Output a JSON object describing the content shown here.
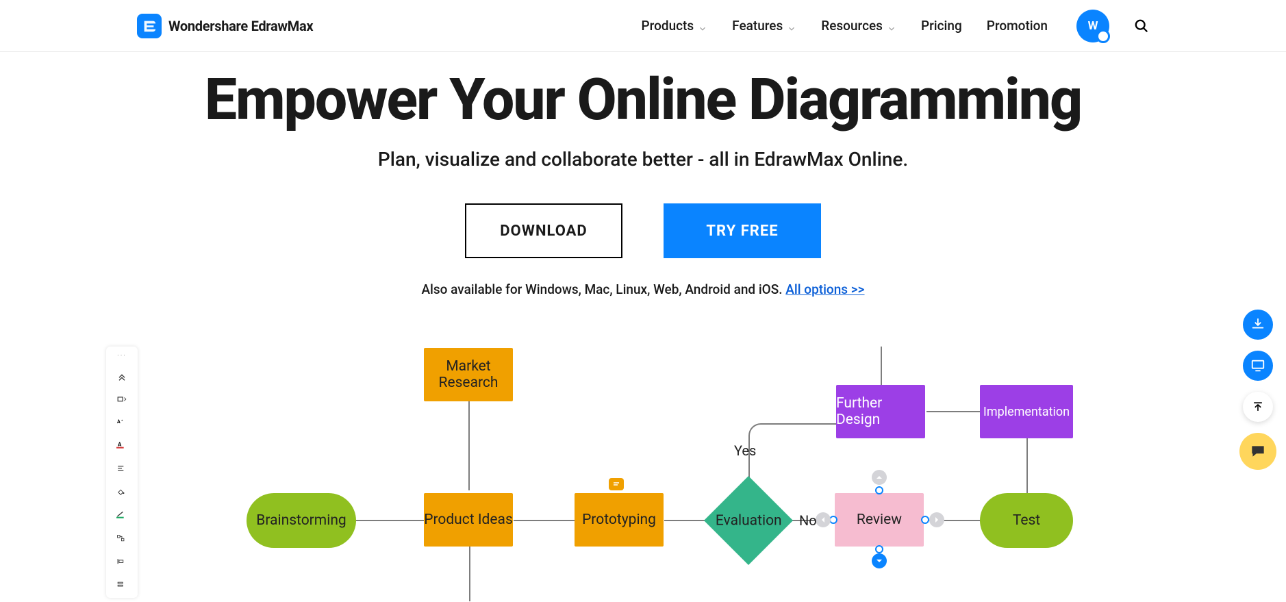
{
  "header": {
    "brand": "Wondershare EdrawMax",
    "nav": {
      "products": "Products",
      "features": "Features",
      "resources": "Resources",
      "pricing": "Pricing",
      "promotion": "Promotion"
    },
    "avatar_initial": "W"
  },
  "hero": {
    "title": "Empower Your Online Diagramming",
    "subtitle": "Plan, visualize and collaborate better - all in EdrawMax Online.",
    "download_label": "DOWNLOAD",
    "try_label": "TRY FREE",
    "availability_prefix": "Also available for Windows, Mac, Linux, Web, Android and iOS. ",
    "availability_link": "All options >>"
  },
  "diagram": {
    "nodes": {
      "brainstorming": "Brainstorming",
      "market_research": "Market Research",
      "product_ideas": "Product Ideas",
      "prototyping": "Prototyping",
      "evaluation": "Evaluation",
      "review": "Review",
      "further_design": "Further Design",
      "implementation": "Implementation",
      "test": "Test"
    },
    "labels": {
      "yes": "Yes",
      "no": "No"
    }
  }
}
